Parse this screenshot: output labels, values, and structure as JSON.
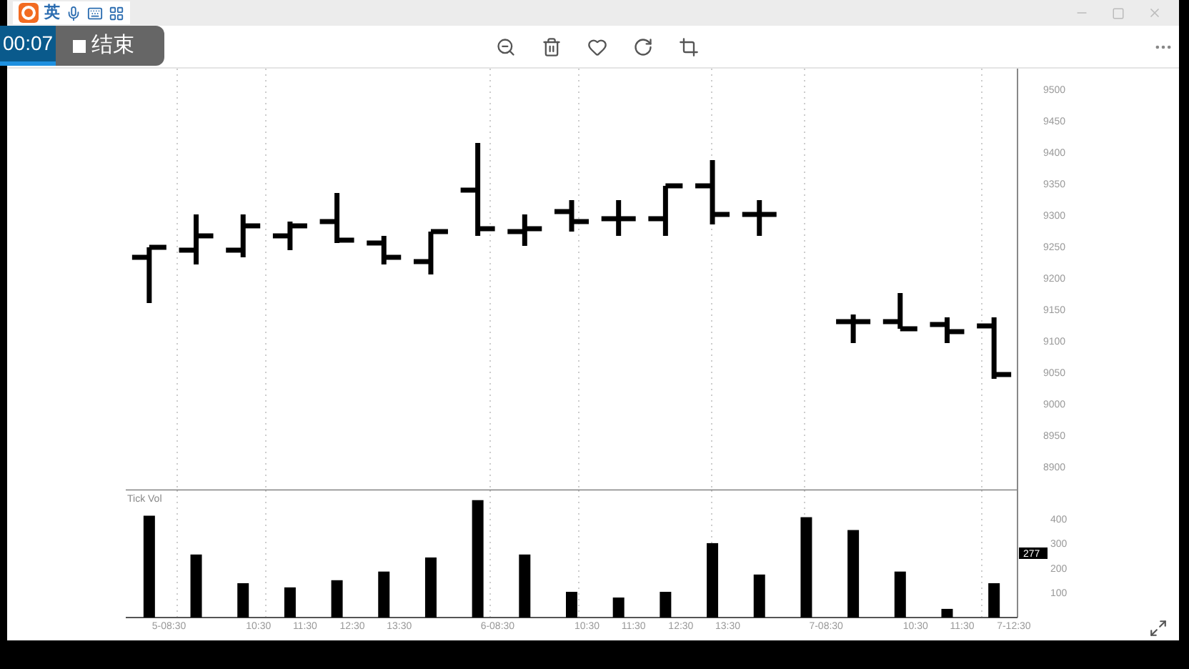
{
  "ime_toolbar": {
    "mode": "英"
  },
  "recorder": {
    "time": "00:07",
    "stop_label": "结束"
  },
  "price_axis": {
    "ticks": [
      "9500",
      "9450",
      "9400",
      "9350",
      "9300",
      "9250",
      "9200",
      "9150",
      "9100",
      "9050",
      "9000",
      "8950",
      "8900"
    ]
  },
  "volume_pane": {
    "label": "Tick Vol",
    "current_value": "277",
    "chart_data": {
      "type": "bar",
      "ylim": [
        0,
        480
      ],
      "yticks": [
        100,
        200,
        300,
        400
      ],
      "values": [
        412,
        255,
        139,
        122,
        151,
        186,
        243,
        475,
        255,
        104,
        81,
        104,
        301,
        174,
        406,
        354,
        186,
        35,
        139
      ]
    }
  },
  "time_axis": [
    "5-08:30",
    "10:30",
    "11:30",
    "12:30",
    "13:30",
    "6-08:30",
    "10:30",
    "11:30",
    "12:30",
    "13:30",
    "7-08:30",
    "10:30",
    "11:30",
    "7-12:30"
  ]
}
